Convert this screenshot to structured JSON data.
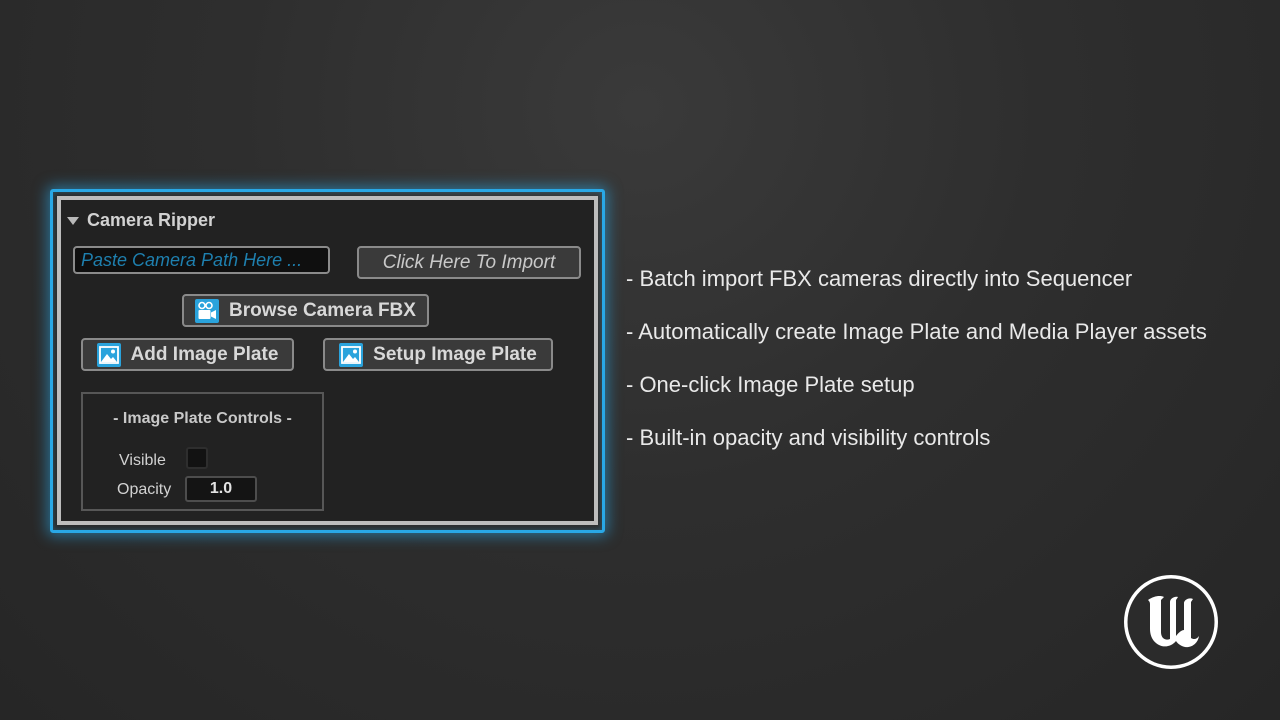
{
  "panel": {
    "title": "Camera Ripper",
    "path_input": {
      "placeholder": "Paste Camera Path Here ...",
      "value": ""
    },
    "buttons": {
      "import": "Click Here To Import",
      "browse": "Browse Camera FBX",
      "add_image_plate": "Add Image Plate",
      "setup_image_plate": "Setup Image Plate"
    },
    "controls": {
      "title": "- Image Plate Controls -",
      "visible_label": "Visible",
      "visible_checked": false,
      "opacity_label": "Opacity",
      "opacity_value": "1.0"
    }
  },
  "features": [
    "- Batch import FBX cameras directly into Sequencer",
    "- Automatically create Image Plate and Media Player assets",
    "- One-click Image Plate setup",
    "- Built-in opacity and visibility controls"
  ],
  "icons": {
    "collapse": "triangle-down-icon",
    "browse": "video-camera-icon",
    "add_image_plate": "image-icon",
    "setup_image_plate": "image-icon",
    "logo": "unreal-engine-logo"
  },
  "colors": {
    "accent": "#29a8e6",
    "background": "#2b2b2b",
    "panel_background": "#222222",
    "placeholder_text": "#1e7fae"
  }
}
